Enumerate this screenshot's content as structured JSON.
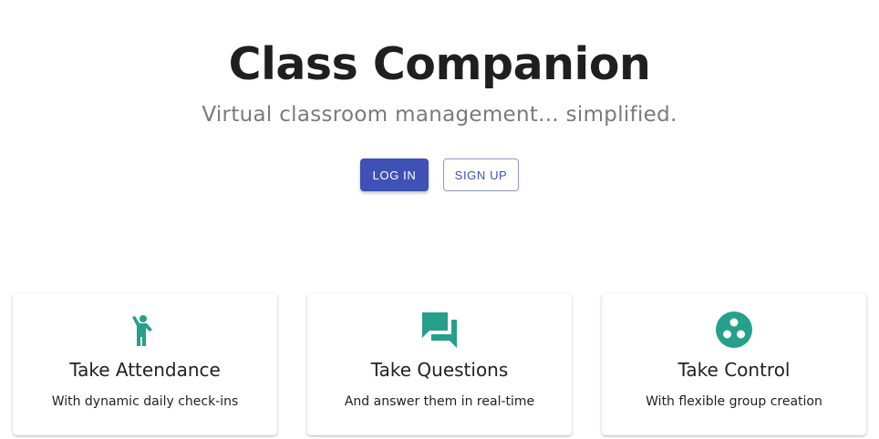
{
  "hero": {
    "title": "Class Companion",
    "subtitle": "Virtual classroom management... simplified."
  },
  "actions": {
    "login_label": "LOG IN",
    "signup_label": "SIGN UP"
  },
  "features": [
    {
      "icon": "person-raising-hand-icon",
      "title": "Take Attendance",
      "description": "With dynamic daily check-ins"
    },
    {
      "icon": "chat-bubbles-icon",
      "title": "Take Questions",
      "description": "And answer them in real-time"
    },
    {
      "icon": "group-circles-icon",
      "title": "Take Control",
      "description": "With flexible group creation"
    }
  ],
  "colors": {
    "primary": "#3f51b5",
    "icon_accent": "#26a08a",
    "title_text": "#1f1f1f",
    "subtitle_text": "#7a7a7a"
  }
}
